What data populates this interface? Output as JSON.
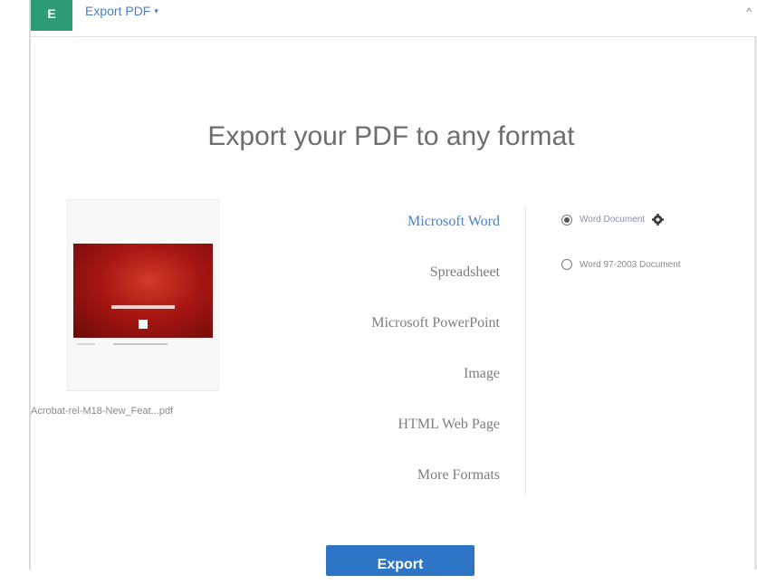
{
  "header": {
    "app_tile": "E",
    "tool_name": "Export PDF",
    "caret": "▾",
    "collapse_arrow": "^"
  },
  "main": {
    "title": "Export your PDF to any format",
    "file_name": "Acrobat-rel-M18-New_Feat...pdf",
    "formats": [
      {
        "label": "Microsoft Word",
        "selected": true
      },
      {
        "label": "Spreadsheet",
        "selected": false
      },
      {
        "label": "Microsoft PowerPoint",
        "selected": false
      },
      {
        "label": "Image",
        "selected": false
      },
      {
        "label": "HTML Web Page",
        "selected": false
      },
      {
        "label": "More Formats",
        "selected": false
      }
    ],
    "options": [
      {
        "label": "Word Document",
        "checked": true,
        "has_settings": true
      },
      {
        "label": "Word 97-2003 Document",
        "checked": false,
        "has_settings": false
      }
    ],
    "export_label": "Export"
  },
  "colors": {
    "accent": "#4a7fc1",
    "button": "#2e74c4",
    "app_tile": "#2e9b77",
    "thumbnail_red": "#a81613"
  },
  "icons": {
    "settings": "gear-icon",
    "collapse": "chevron-up-icon",
    "dropdown": "caret-down-icon"
  }
}
